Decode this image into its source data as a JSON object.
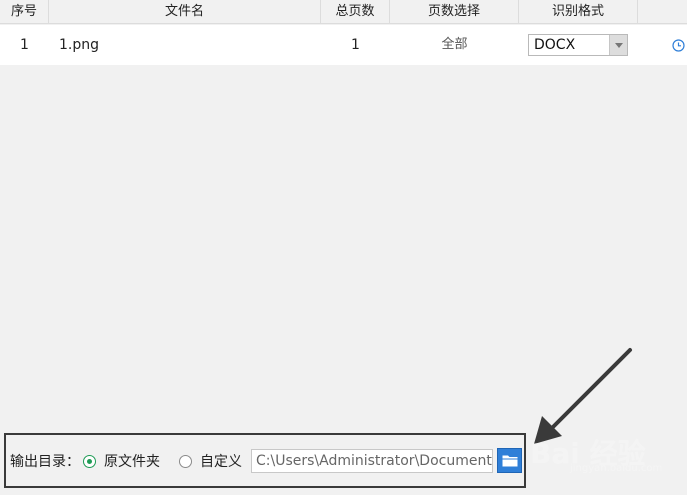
{
  "table": {
    "headers": [
      "序号",
      "文件名",
      "总页数",
      "页数选择",
      "识别格式",
      ""
    ],
    "rows": [
      {
        "index": "1",
        "filename": "1.png",
        "total_pages": "1",
        "page_selection": "全部",
        "format": "DOCX"
      }
    ]
  },
  "output": {
    "label": "输出目录：",
    "option_original": "原文件夹",
    "option_custom": "自定义",
    "selected": "original",
    "path": "C:\\Users\\Administrator\\Documents",
    "accent_color": "#1e9b55",
    "button_color": "#2f7fd8"
  },
  "watermark": {
    "text": "Bai 经验",
    "sub": "jingyan.baidu.com"
  }
}
